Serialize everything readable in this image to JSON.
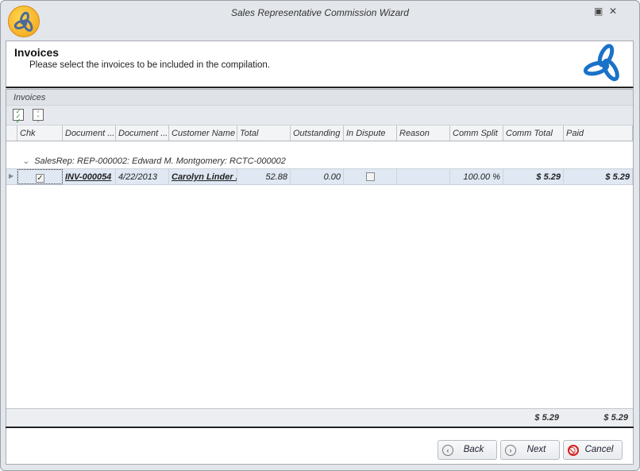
{
  "window": {
    "title": "Sales Representative Commission Wizard"
  },
  "header": {
    "title": "Invoices",
    "subtitle": "Please select the invoices to be included in the compilation."
  },
  "grid": {
    "group_panel_label": "Invoices",
    "columns": [
      "Chk",
      "Document ...",
      "Document ...",
      "Customer Name",
      "Total",
      "Outstanding",
      "In Dispute",
      "Reason",
      "Comm Split",
      "Comm Total",
      "Paid"
    ],
    "group_row": "SalesRep: REP-000002: Edward M. Montgomery: RCTC-000002",
    "rows": [
      {
        "chk": true,
        "document_no": "INV-000054",
        "document_date": "4/22/2013",
        "customer": "Carolyn Linder ...",
        "total": "52.88",
        "outstanding": "0.00",
        "in_dispute": false,
        "reason": "",
        "comm_split": "100.00 %",
        "comm_total": "$ 5.29",
        "paid": "$ 5.29"
      }
    ],
    "footer": {
      "comm_total": "$ 5.29",
      "paid": "$ 5.29"
    }
  },
  "buttons": {
    "back": "Back",
    "next": "Next",
    "cancel": "Cancel"
  }
}
